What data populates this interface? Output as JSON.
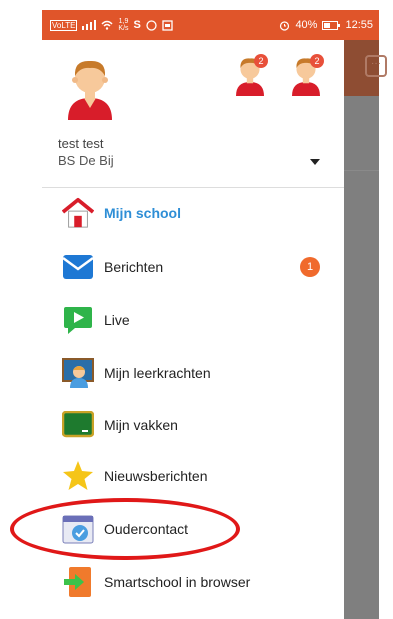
{
  "status_bar": {
    "network_label": "VoLTE",
    "speed_top": "1,9",
    "speed_bottom": "K/s",
    "letter": "S",
    "battery_percent": "40%",
    "time": "12:55"
  },
  "drawer": {
    "user_name": "test test",
    "school_name": "BS De Bij",
    "child_badges": [
      "2",
      "2"
    ],
    "menu": [
      {
        "label": "Mijn school",
        "active": true,
        "icon": "house-icon"
      },
      {
        "label": "Berichten",
        "badge": "1",
        "icon": "envelope-icon"
      },
      {
        "label": "Live",
        "icon": "video-play-icon"
      },
      {
        "label": "Mijn leerkrachten",
        "icon": "teacher-icon"
      },
      {
        "label": "Mijn vakken",
        "icon": "chalkboard-icon"
      },
      {
        "label": "Nieuwsberichten",
        "icon": "star-icon"
      },
      {
        "label": "Oudercontact",
        "icon": "calendar-clock-icon"
      },
      {
        "label": "Smartschool in browser",
        "icon": "browser-arrow-icon"
      }
    ]
  },
  "colors": {
    "status_bar": "#e0552a",
    "active_text": "#2e8ed6",
    "badge": "#f06a2c",
    "highlight": "#e01818"
  }
}
